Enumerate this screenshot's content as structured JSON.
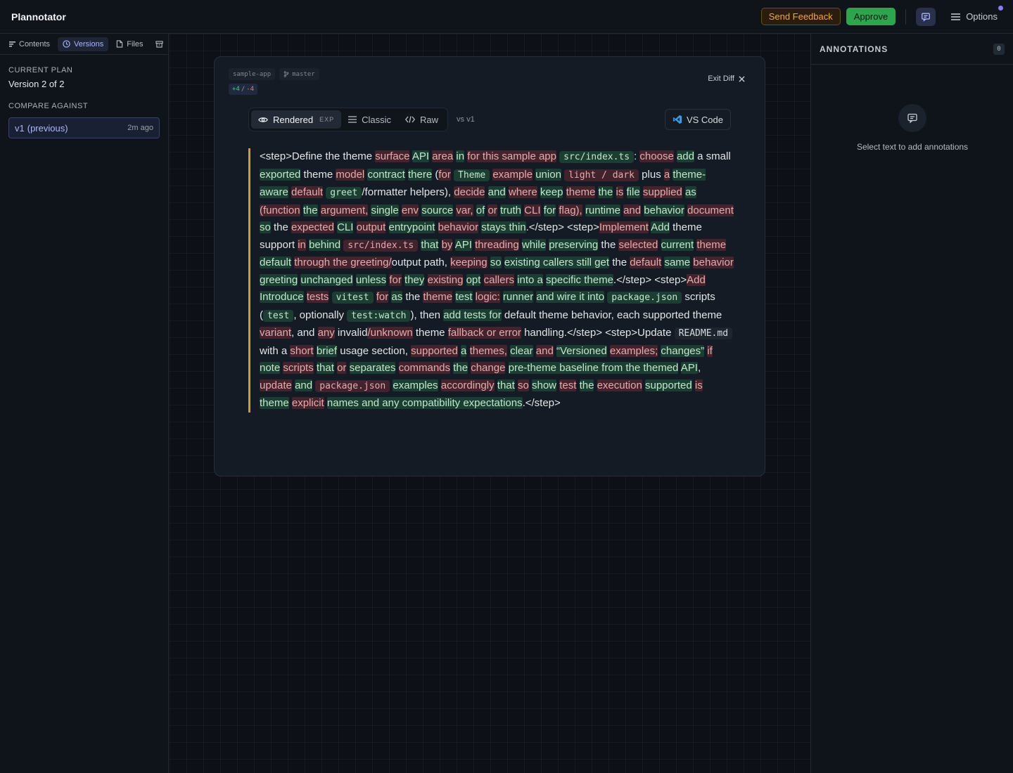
{
  "header": {
    "title": "Plannotator",
    "feedback_label": "Send Feedback",
    "approve_label": "Approve",
    "options_label": "Options"
  },
  "sidebar": {
    "tabs": [
      {
        "label": "Contents",
        "icon": "list-icon"
      },
      {
        "label": "Versions",
        "icon": "clock-icon",
        "active": true
      },
      {
        "label": "Files",
        "icon": "file-icon"
      }
    ],
    "current_plan_label": "CURRENT PLAN",
    "current_plan_value": "Version 2 of 2",
    "compare_label": "COMPARE AGAINST",
    "compare_item": {
      "name": "v1",
      "tag": "(previous)",
      "time": "2m ago"
    }
  },
  "doc": {
    "repo": "sample-app",
    "branch": "master",
    "added": "+4",
    "sep": "/",
    "removed": "-4",
    "exit_label": "Exit Diff",
    "view_modes": [
      {
        "label": "Rendered",
        "badge": "EXP",
        "active": true
      },
      {
        "label": "Classic"
      },
      {
        "label": "Raw"
      }
    ],
    "vs_label": "vs v1",
    "vscode_label": "VS Code",
    "segments": [
      {
        "t": "<step>Define the theme ",
        "k": ""
      },
      {
        "t": "surface",
        "k": "del"
      },
      {
        "t": " ",
        "k": ""
      },
      {
        "t": "API",
        "k": "ins"
      },
      {
        "t": " ",
        "k": ""
      },
      {
        "t": "area",
        "k": "del"
      },
      {
        "t": " ",
        "k": ""
      },
      {
        "t": "in",
        "k": "ins"
      },
      {
        "t": " ",
        "k": ""
      },
      {
        "t": "for this sample app",
        "k": "del"
      },
      {
        "t": " ",
        "k": ""
      },
      {
        "t": "src/index.ts",
        "k": "ins",
        "code": true
      },
      {
        "t": ": ",
        "k": ""
      },
      {
        "t": "choose",
        "k": "del"
      },
      {
        "t": " ",
        "k": ""
      },
      {
        "t": "add",
        "k": "ins"
      },
      {
        "t": " a small ",
        "k": ""
      },
      {
        "t": "exported",
        "k": "ins"
      },
      {
        "t": " theme ",
        "k": ""
      },
      {
        "t": "model",
        "k": "del"
      },
      {
        "t": " ",
        "k": ""
      },
      {
        "t": "contract",
        "k": "ins"
      },
      {
        "t": " ",
        "k": ""
      },
      {
        "t": "there",
        "k": "ins"
      },
      {
        "t": " (",
        "k": ""
      },
      {
        "t": "for",
        "k": "del"
      },
      {
        "t": " ",
        "k": ""
      },
      {
        "t": "Theme",
        "k": "ins",
        "code": true
      },
      {
        "t": " ",
        "k": ""
      },
      {
        "t": "example",
        "k": "del"
      },
      {
        "t": " ",
        "k": ""
      },
      {
        "t": "union",
        "k": "ins"
      },
      {
        "t": " ",
        "k": ""
      },
      {
        "t": "light / dark",
        "k": "del",
        "code": true
      },
      {
        "t": " plus ",
        "k": ""
      },
      {
        "t": "a",
        "k": "del"
      },
      {
        "t": " ",
        "k": ""
      },
      {
        "t": "theme-aware",
        "k": "ins"
      },
      {
        "t": " ",
        "k": ""
      },
      {
        "t": "default",
        "k": "del"
      },
      {
        "t": " ",
        "k": ""
      },
      {
        "t": "greet",
        "k": "ins",
        "code": true
      },
      {
        "t": "/formatter helpers), ",
        "k": ""
      },
      {
        "t": "decide",
        "k": "del"
      },
      {
        "t": " ",
        "k": ""
      },
      {
        "t": "and",
        "k": "ins"
      },
      {
        "t": " ",
        "k": ""
      },
      {
        "t": "where",
        "k": "del"
      },
      {
        "t": " ",
        "k": ""
      },
      {
        "t": "keep",
        "k": "ins"
      },
      {
        "t": " ",
        "k": ""
      },
      {
        "t": "theme",
        "k": "del"
      },
      {
        "t": " ",
        "k": ""
      },
      {
        "t": "the",
        "k": "ins"
      },
      {
        "t": " ",
        "k": ""
      },
      {
        "t": "is",
        "k": "del"
      },
      {
        "t": " ",
        "k": ""
      },
      {
        "t": "file",
        "k": "ins"
      },
      {
        "t": " ",
        "k": ""
      },
      {
        "t": "supplied",
        "k": "del"
      },
      {
        "t": " ",
        "k": ""
      },
      {
        "t": "as",
        "k": "ins"
      },
      {
        "t": " ",
        "k": ""
      },
      {
        "t": "(function",
        "k": "del"
      },
      {
        "t": " ",
        "k": ""
      },
      {
        "t": "the",
        "k": "ins"
      },
      {
        "t": " ",
        "k": ""
      },
      {
        "t": "argument,",
        "k": "del"
      },
      {
        "t": " ",
        "k": ""
      },
      {
        "t": "single",
        "k": "ins"
      },
      {
        "t": " ",
        "k": ""
      },
      {
        "t": "env",
        "k": "del"
      },
      {
        "t": " ",
        "k": ""
      },
      {
        "t": "source",
        "k": "ins"
      },
      {
        "t": " ",
        "k": ""
      },
      {
        "t": "var,",
        "k": "del"
      },
      {
        "t": " ",
        "k": ""
      },
      {
        "t": "of",
        "k": "ins"
      },
      {
        "t": " ",
        "k": ""
      },
      {
        "t": "or",
        "k": "del"
      },
      {
        "t": " ",
        "k": ""
      },
      {
        "t": "truth",
        "k": "ins"
      },
      {
        "t": " ",
        "k": ""
      },
      {
        "t": "CLI",
        "k": "del"
      },
      {
        "t": " ",
        "k": ""
      },
      {
        "t": "for",
        "k": "ins"
      },
      {
        "t": " ",
        "k": ""
      },
      {
        "t": "flag),",
        "k": "del"
      },
      {
        "t": " ",
        "k": ""
      },
      {
        "t": "runtime",
        "k": "ins"
      },
      {
        "t": " ",
        "k": ""
      },
      {
        "t": "and",
        "k": "del"
      },
      {
        "t": " ",
        "k": ""
      },
      {
        "t": "behavior",
        "k": "ins"
      },
      {
        "t": " ",
        "k": ""
      },
      {
        "t": "document",
        "k": "del"
      },
      {
        "t": " ",
        "k": ""
      },
      {
        "t": "so",
        "k": "ins"
      },
      {
        "t": " the ",
        "k": ""
      },
      {
        "t": "expected",
        "k": "del"
      },
      {
        "t": " ",
        "k": ""
      },
      {
        "t": "CLI",
        "k": "ins"
      },
      {
        "t": " ",
        "k": ""
      },
      {
        "t": "output",
        "k": "del"
      },
      {
        "t": " ",
        "k": ""
      },
      {
        "t": "entrypoint",
        "k": "ins"
      },
      {
        "t": " ",
        "k": ""
      },
      {
        "t": "behavior",
        "k": "del"
      },
      {
        "t": " ",
        "k": ""
      },
      {
        "t": "stays thin",
        "k": "ins"
      },
      {
        "t": ".</step> <step>",
        "k": ""
      },
      {
        "t": "Implement",
        "k": "del"
      },
      {
        "t": " ",
        "k": ""
      },
      {
        "t": "Add",
        "k": "ins"
      },
      {
        "t": " theme support ",
        "k": ""
      },
      {
        "t": "in",
        "k": "del"
      },
      {
        "t": " ",
        "k": ""
      },
      {
        "t": "behind",
        "k": "ins"
      },
      {
        "t": " ",
        "k": ""
      },
      {
        "t": "src/index.ts",
        "k": "del",
        "code": true
      },
      {
        "t": " ",
        "k": ""
      },
      {
        "t": "that",
        "k": "ins"
      },
      {
        "t": " ",
        "k": ""
      },
      {
        "t": "by",
        "k": "del"
      },
      {
        "t": " ",
        "k": ""
      },
      {
        "t": "API",
        "k": "ins"
      },
      {
        "t": " ",
        "k": ""
      },
      {
        "t": "threading",
        "k": "del"
      },
      {
        "t": " ",
        "k": ""
      },
      {
        "t": "while",
        "k": "ins"
      },
      {
        "t": " ",
        "k": ""
      },
      {
        "t": "preserving",
        "k": "ins"
      },
      {
        "t": " the ",
        "k": ""
      },
      {
        "t": "selected",
        "k": "del"
      },
      {
        "t": " ",
        "k": ""
      },
      {
        "t": "current",
        "k": "ins"
      },
      {
        "t": " ",
        "k": ""
      },
      {
        "t": "theme",
        "k": "del"
      },
      {
        "t": " ",
        "k": ""
      },
      {
        "t": "default",
        "k": "ins"
      },
      {
        "t": " ",
        "k": ""
      },
      {
        "t": "through the greeting/",
        "k": "del"
      },
      {
        "t": "output path, ",
        "k": ""
      },
      {
        "t": "keeping",
        "k": "del"
      },
      {
        "t": " ",
        "k": ""
      },
      {
        "t": "so",
        "k": "ins"
      },
      {
        "t": " ",
        "k": ""
      },
      {
        "t": "existing callers still get",
        "k": "ins"
      },
      {
        "t": " the ",
        "k": ""
      },
      {
        "t": "default",
        "k": "del"
      },
      {
        "t": " ",
        "k": ""
      },
      {
        "t": "same",
        "k": "ins"
      },
      {
        "t": " ",
        "k": ""
      },
      {
        "t": "behavior",
        "k": "del"
      },
      {
        "t": " ",
        "k": ""
      },
      {
        "t": "greeting",
        "k": "ins"
      },
      {
        "t": " ",
        "k": ""
      },
      {
        "t": "unchanged",
        "k": "ins"
      },
      {
        "t": " ",
        "k": ""
      },
      {
        "t": "unless",
        "k": "ins"
      },
      {
        "t": " ",
        "k": ""
      },
      {
        "t": "for",
        "k": "del"
      },
      {
        "t": " ",
        "k": ""
      },
      {
        "t": "they",
        "k": "ins"
      },
      {
        "t": " ",
        "k": ""
      },
      {
        "t": "existing",
        "k": "del"
      },
      {
        "t": " ",
        "k": ""
      },
      {
        "t": "opt",
        "k": "ins"
      },
      {
        "t": " ",
        "k": ""
      },
      {
        "t": "callers",
        "k": "del"
      },
      {
        "t": " ",
        "k": ""
      },
      {
        "t": "into a",
        "k": "ins"
      },
      {
        "t": " ",
        "k": ""
      },
      {
        "t": "specific theme",
        "k": "ins"
      },
      {
        "t": ".</step> <step>",
        "k": ""
      },
      {
        "t": "Add",
        "k": "del"
      },
      {
        "t": " ",
        "k": ""
      },
      {
        "t": "Introduce",
        "k": "ins"
      },
      {
        "t": " ",
        "k": ""
      },
      {
        "t": "tests",
        "k": "del"
      },
      {
        "t": " ",
        "k": ""
      },
      {
        "t": "vitest",
        "k": "ins",
        "code": true
      },
      {
        "t": " ",
        "k": ""
      },
      {
        "t": "for",
        "k": "del"
      },
      {
        "t": " ",
        "k": ""
      },
      {
        "t": "as",
        "k": "ins"
      },
      {
        "t": " the ",
        "k": ""
      },
      {
        "t": "theme",
        "k": "del"
      },
      {
        "t": " ",
        "k": ""
      },
      {
        "t": "test",
        "k": "ins"
      },
      {
        "t": " ",
        "k": ""
      },
      {
        "t": "logic:",
        "k": "del"
      },
      {
        "t": " ",
        "k": ""
      },
      {
        "t": "runner",
        "k": "ins"
      },
      {
        "t": " ",
        "k": ""
      },
      {
        "t": "and wire it into",
        "k": "ins"
      },
      {
        "t": " ",
        "k": ""
      },
      {
        "t": "package.json",
        "k": "ins",
        "code": true
      },
      {
        "t": " scripts (",
        "k": ""
      },
      {
        "t": "test",
        "k": "ins",
        "code": true
      },
      {
        "t": ", optionally ",
        "k": ""
      },
      {
        "t": "test:watch",
        "k": "ins",
        "code": true
      },
      {
        "t": "), then ",
        "k": ""
      },
      {
        "t": "add tests for",
        "k": "ins"
      },
      {
        "t": " default theme behavior, each supported theme ",
        "k": ""
      },
      {
        "t": "variant",
        "k": "del"
      },
      {
        "t": ", and ",
        "k": ""
      },
      {
        "t": "any",
        "k": "del"
      },
      {
        "t": " ",
        "k": ""
      },
      {
        "t": "invalid",
        "k": ""
      },
      {
        "t": "/unknown",
        "k": "del"
      },
      {
        "t": " theme ",
        "k": ""
      },
      {
        "t": "fallback or error",
        "k": "del"
      },
      {
        "t": " handling.</step> <step>Update ",
        "k": ""
      },
      {
        "t": "README.md",
        "k": "eq",
        "code": true
      },
      {
        "t": " with a ",
        "k": ""
      },
      {
        "t": "short",
        "k": "del"
      },
      {
        "t": " ",
        "k": ""
      },
      {
        "t": "brief",
        "k": "ins"
      },
      {
        "t": " usage section, ",
        "k": ""
      },
      {
        "t": "supported",
        "k": "del"
      },
      {
        "t": " ",
        "k": ""
      },
      {
        "t": "a",
        "k": "ins"
      },
      {
        "t": " ",
        "k": ""
      },
      {
        "t": "themes,",
        "k": "del"
      },
      {
        "t": " ",
        "k": ""
      },
      {
        "t": "clear",
        "k": "ins"
      },
      {
        "t": " ",
        "k": ""
      },
      {
        "t": "and",
        "k": "del"
      },
      {
        "t": " ",
        "k": ""
      },
      {
        "t": "“Versioned",
        "k": "ins"
      },
      {
        "t": " ",
        "k": ""
      },
      {
        "t": "examples;",
        "k": "del"
      },
      {
        "t": " ",
        "k": ""
      },
      {
        "t": "changes”",
        "k": "ins"
      },
      {
        "t": " ",
        "k": ""
      },
      {
        "t": "if",
        "k": "del"
      },
      {
        "t": " ",
        "k": ""
      },
      {
        "t": "note",
        "k": "ins"
      },
      {
        "t": " ",
        "k": ""
      },
      {
        "t": "scripts",
        "k": "del"
      },
      {
        "t": " ",
        "k": ""
      },
      {
        "t": "that",
        "k": "ins"
      },
      {
        "t": " ",
        "k": ""
      },
      {
        "t": "or",
        "k": "del"
      },
      {
        "t": " ",
        "k": ""
      },
      {
        "t": "separates",
        "k": "ins"
      },
      {
        "t": " ",
        "k": ""
      },
      {
        "t": "commands",
        "k": "del"
      },
      {
        "t": " ",
        "k": ""
      },
      {
        "t": "the",
        "k": "ins"
      },
      {
        "t": " ",
        "k": ""
      },
      {
        "t": "change",
        "k": "del"
      },
      {
        "t": " ",
        "k": ""
      },
      {
        "t": "pre-theme baseline from the themed",
        "k": "ins"
      },
      {
        "t": " ",
        "k": ""
      },
      {
        "t": "API",
        "k": "ins"
      },
      {
        "t": ", ",
        "k": ""
      },
      {
        "t": "update",
        "k": "del"
      },
      {
        "t": " ",
        "k": ""
      },
      {
        "t": "and",
        "k": "ins"
      },
      {
        "t": " ",
        "k": ""
      },
      {
        "t": "package.json",
        "k": "del",
        "code": true
      },
      {
        "t": " ",
        "k": ""
      },
      {
        "t": "examples",
        "k": "ins"
      },
      {
        "t": " ",
        "k": ""
      },
      {
        "t": "accordingly",
        "k": "del"
      },
      {
        "t": " ",
        "k": ""
      },
      {
        "t": "that",
        "k": "ins"
      },
      {
        "t": " ",
        "k": ""
      },
      {
        "t": "so",
        "k": "del"
      },
      {
        "t": " ",
        "k": ""
      },
      {
        "t": "show",
        "k": "ins"
      },
      {
        "t": " ",
        "k": ""
      },
      {
        "t": "test",
        "k": "del"
      },
      {
        "t": " ",
        "k": ""
      },
      {
        "t": "the",
        "k": "ins"
      },
      {
        "t": " ",
        "k": ""
      },
      {
        "t": "execution",
        "k": "del"
      },
      {
        "t": " ",
        "k": ""
      },
      {
        "t": "supported",
        "k": "ins"
      },
      {
        "t": " ",
        "k": ""
      },
      {
        "t": "is",
        "k": "del"
      },
      {
        "t": " ",
        "k": ""
      },
      {
        "t": "theme",
        "k": "ins"
      },
      {
        "t": " ",
        "k": ""
      },
      {
        "t": "explicit",
        "k": "del"
      },
      {
        "t": " ",
        "k": ""
      },
      {
        "t": "names and any compatibility expectations",
        "k": "ins"
      },
      {
        "t": ".</step>",
        "k": ""
      }
    ]
  },
  "annotations": {
    "title": "ANNOTATIONS",
    "count": "0",
    "empty_text": "Select text to add annotations"
  },
  "colors": {
    "accent": "#8b7cf6",
    "approve": "#2ea44f",
    "feedback": "#f2a541",
    "insert_bg": "#1f5136",
    "delete_bg": "#4a2226",
    "diff_border": "#c9a227"
  }
}
